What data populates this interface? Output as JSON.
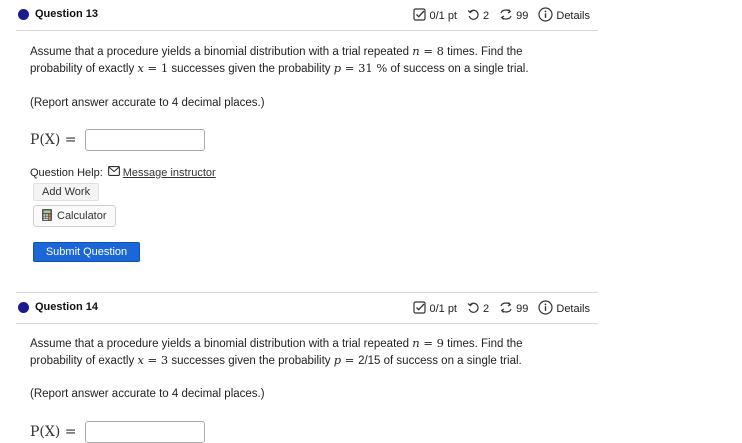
{
  "q1": {
    "title": "Question 13",
    "score": "0/1 pt",
    "retries": "2",
    "attempts": "99",
    "details": "Details",
    "text1_a": "Assume that a procedure yields a binomial distribution with a trial repeated ",
    "n_sym": "n",
    "eq": " = ",
    "n_val": "8",
    "text1_b": " times. Find the",
    "text2_a": "probability of exactly ",
    "x_sym": "x",
    "x_val": "1",
    "text2_b": " successes given the probability ",
    "p_sym": "p",
    "p_val": "31 %",
    "text2_c": " of success on a single trial.",
    "report": "(Report answer accurate to 4 decimal places.)",
    "answer_label": "P(X) =",
    "answer_value": "",
    "help_label": "Question Help:",
    "message_link": "Message instructor",
    "add_work": "Add Work",
    "calculator": "Calculator",
    "submit": "Submit Question"
  },
  "q2": {
    "title": "Question 14",
    "score": "0/1 pt",
    "retries": "2",
    "attempts": "99",
    "details": "Details",
    "text1_a": "Assume that a procedure yields a binomial distribution with a trial repeated ",
    "n_sym": "n",
    "eq": " = ",
    "n_val": "9",
    "text1_b": " times. Find the",
    "text2_a": "probability of exactly ",
    "x_sym": "x",
    "x_val": "3",
    "text2_b": " successes given the probability ",
    "p_sym": "p",
    "p_val": "2/15",
    "text2_c": " of success on a single trial.",
    "report": "(Report answer accurate to 4 decimal places.)",
    "answer_label": "P(X) =",
    "answer_value": ""
  },
  "icons": {
    "score": "checkbox-icon",
    "retries": "retry-icon",
    "attempts": "attempts-icon",
    "details": "info-icon",
    "message": "envelope-icon",
    "calculator": "calculator-icon"
  },
  "colors": {
    "dot": "#1a1b8f",
    "submit": "#1b67d8"
  }
}
